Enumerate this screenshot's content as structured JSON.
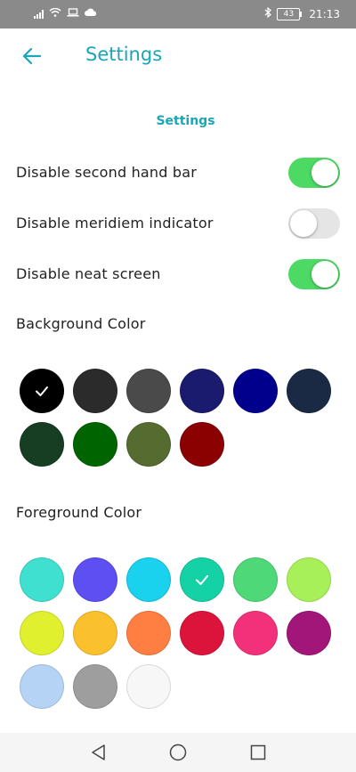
{
  "status_bar": {
    "time": "21:13",
    "battery": "43",
    "icons": [
      "signal-icon",
      "wifi-icon",
      "laptop-icon",
      "cloud-icon",
      "bluetooth-icon",
      "battery-icon"
    ]
  },
  "app_bar": {
    "title": "Settings",
    "back_icon": "back-arrow-icon"
  },
  "section_title": "Settings",
  "toggles": [
    {
      "label": "Disable second hand bar",
      "on": true
    },
    {
      "label": "Disable meridiem indicator",
      "on": false
    },
    {
      "label": "Disable neat screen",
      "on": true
    }
  ],
  "background_color": {
    "label": "Background Color",
    "selected_index": 0,
    "colors": [
      "#000000",
      "#2b2b2b",
      "#4a4a4a",
      "#1a1a6e",
      "#00008c",
      "#1b2a44",
      "#173d22",
      "#006400",
      "#556b2f",
      "#8b0000"
    ]
  },
  "foreground_color": {
    "label": "Foreground Color",
    "selected_index": 3,
    "colors": [
      "#40e0d0",
      "#5d4ff2",
      "#1ad1ee",
      "#14d2a6",
      "#4fd878",
      "#a8f05a",
      "#e0f02e",
      "#fbc02d",
      "#ff7f43",
      "#dc143c",
      "#f2317a",
      "#a2167a",
      "#b5d3f5",
      "#9e9e9e",
      "#f7f7f7"
    ]
  },
  "nav": [
    "back-triangle-icon",
    "home-circle-icon",
    "recents-square-icon"
  ],
  "colors": {
    "accent": "#1aa6b7",
    "toggle_on": "#4cd964",
    "toggle_off": "#e5e5e5",
    "status_bar": "#8a8a8a"
  }
}
